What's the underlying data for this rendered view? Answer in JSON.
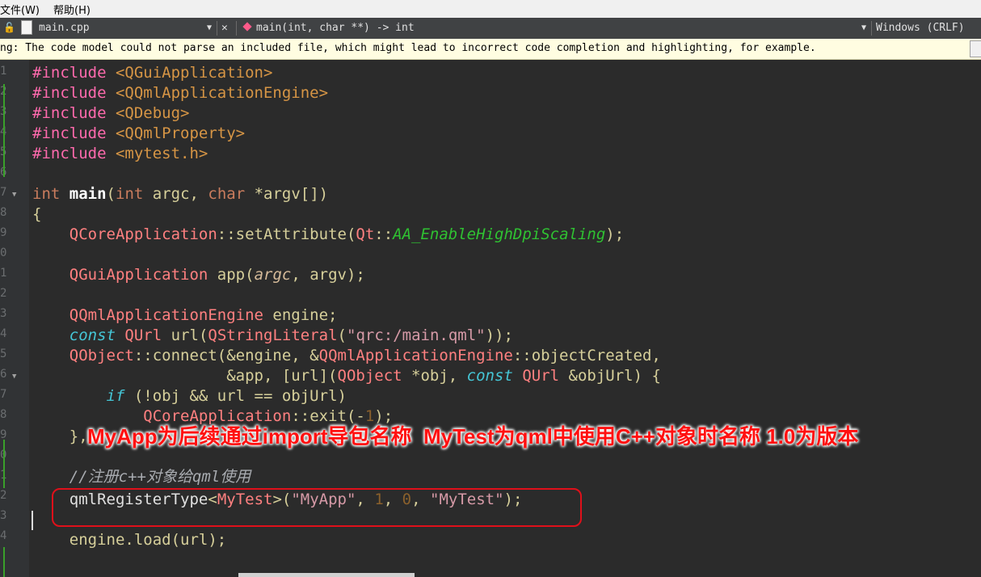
{
  "menu": {
    "file": "文件(W)",
    "help": "帮助(H)"
  },
  "toolbar": {
    "file_name": "main.cpp",
    "function_sig": "main(int, char **) -> int",
    "line_ending": "Windows (CRLF)"
  },
  "warning": {
    "text": "ng: The code model could not parse an included file, which might lead to incorrect code completion and highlighting, for example."
  },
  "gutter": {
    "line_digits": [
      "1",
      "2",
      "3",
      "4",
      "5",
      "6",
      "7",
      "8",
      "9",
      "0",
      "1",
      "2",
      "3",
      "4",
      "5",
      "6",
      "7",
      "8",
      "9",
      "0",
      "1",
      "2",
      "3",
      "4"
    ]
  },
  "code": {
    "l1": [
      "#include",
      " <QGuiApplication>"
    ],
    "l2": [
      "#include",
      " <QQmlApplicationEngine>"
    ],
    "l3": [
      "#include",
      " <QDebug>"
    ],
    "l4": [
      "#include",
      " <QQmlProperty>"
    ],
    "l5": [
      "#include",
      " <mytest.h>"
    ],
    "l7": [
      "int",
      " ",
      "main",
      "(",
      "int",
      " argc, ",
      "char",
      " *argv[])"
    ],
    "l8": "{",
    "l9": [
      "    ",
      "QCoreApplication",
      "::setAttribute(",
      "Qt",
      "::",
      "AA_EnableHighDpiScaling",
      ");"
    ],
    "l11": [
      "    ",
      "QGuiApplication",
      " app(",
      "argc",
      ", argv);"
    ],
    "l13": [
      "    ",
      "QQmlApplicationEngine",
      " engine;"
    ],
    "l14": [
      "    ",
      "const",
      " ",
      "QUrl",
      " url(",
      "QStringLiteral",
      "(",
      "\"qrc:/main.qml\"",
      "));"
    ],
    "l15": [
      "    ",
      "QObject",
      "::connect(&engine, &",
      "QQmlApplicationEngine",
      "::objectCreated,"
    ],
    "l16": [
      "                     &app, [url](",
      "QObject",
      " *obj, ",
      "const",
      " ",
      "QUrl",
      " &objUrl) {"
    ],
    "l17": [
      "        ",
      "if",
      " (!obj && url == objUrl)"
    ],
    "l18": [
      "            ",
      "QCoreApplication",
      "::exit(-",
      "1",
      ");"
    ],
    "l19": "    },",
    "l21": "    //注册c++对象给qml使用",
    "l22": [
      "    ",
      "qmlRegisterType",
      "<",
      "MyTest",
      ">(",
      "\"MyApp\"",
      ", ",
      "1",
      ", ",
      "0",
      ", ",
      "\"MyTest\"",
      ");"
    ],
    "l24": "    engine.load(url);"
  },
  "annotation": {
    "text": "MyApp为后续通过import导包名称  MyTest为qml中使用C++对象时名称 1.0为版本"
  },
  "colors": {
    "annotation": "#ff1010",
    "ring": "#e0101a",
    "editor_bg": "#2b2b2b"
  }
}
